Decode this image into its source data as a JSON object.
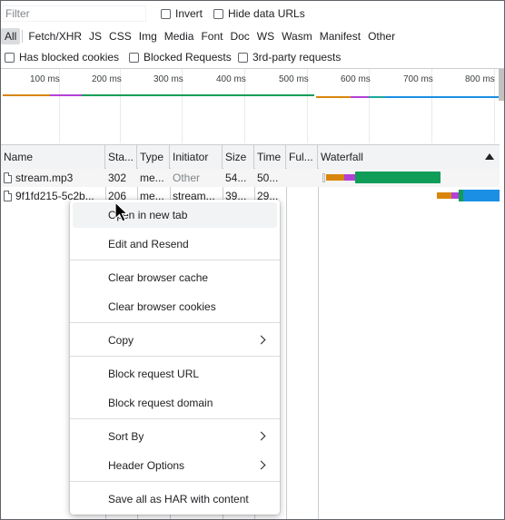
{
  "filter": {
    "placeholder": "Filter"
  },
  "toolbar": {
    "invert_label": "Invert",
    "hide_data_urls_label": "Hide data URLs",
    "types": [
      "All",
      "Fetch/XHR",
      "JS",
      "CSS",
      "Img",
      "Media",
      "Font",
      "Doc",
      "WS",
      "Wasm",
      "Manifest",
      "Other"
    ],
    "has_blocked_cookies_label": "Has blocked cookies",
    "blocked_requests_label": "Blocked Requests",
    "third_party_label": "3rd-party requests"
  },
  "overview": {
    "ticks": [
      "100 ms",
      "200 ms",
      "300 ms",
      "400 ms",
      "500 ms",
      "600 ms",
      "700 ms",
      "800 ms"
    ]
  },
  "table": {
    "columns": [
      "Name",
      "Sta...",
      "Type",
      "Initiator",
      "Size",
      "Time",
      "Ful...",
      "Waterfall"
    ],
    "rows": [
      {
        "name": "stream.mp3",
        "status": "302",
        "type": "me...",
        "initiator": "Other",
        "size": "54...",
        "time": "50..."
      },
      {
        "name": "9f1fd215-5c2b...",
        "status": "206",
        "type": "me...",
        "initiator": "stream...",
        "size": "39...",
        "time": "29..."
      }
    ]
  },
  "context_menu": {
    "items": [
      {
        "label": "Open in new tab",
        "submenu": false
      },
      {
        "label": "Edit and Resend",
        "submenu": false
      },
      {
        "label": "Clear browser cache",
        "submenu": false
      },
      {
        "label": "Clear browser cookies",
        "submenu": false
      },
      {
        "label": "Copy",
        "submenu": true
      },
      {
        "label": "Block request URL",
        "submenu": false
      },
      {
        "label": "Block request domain",
        "submenu": false
      },
      {
        "label": "Sort By",
        "submenu": true
      },
      {
        "label": "Header Options",
        "submenu": true
      },
      {
        "label": "Save all as HAR with content",
        "submenu": false
      }
    ]
  },
  "colors": {
    "waiting": "#d8860b",
    "ssl": "#b342d6",
    "download_green": "#0f9d58",
    "download_blue": "#1a8fe3",
    "teal": "#1aa89a"
  }
}
